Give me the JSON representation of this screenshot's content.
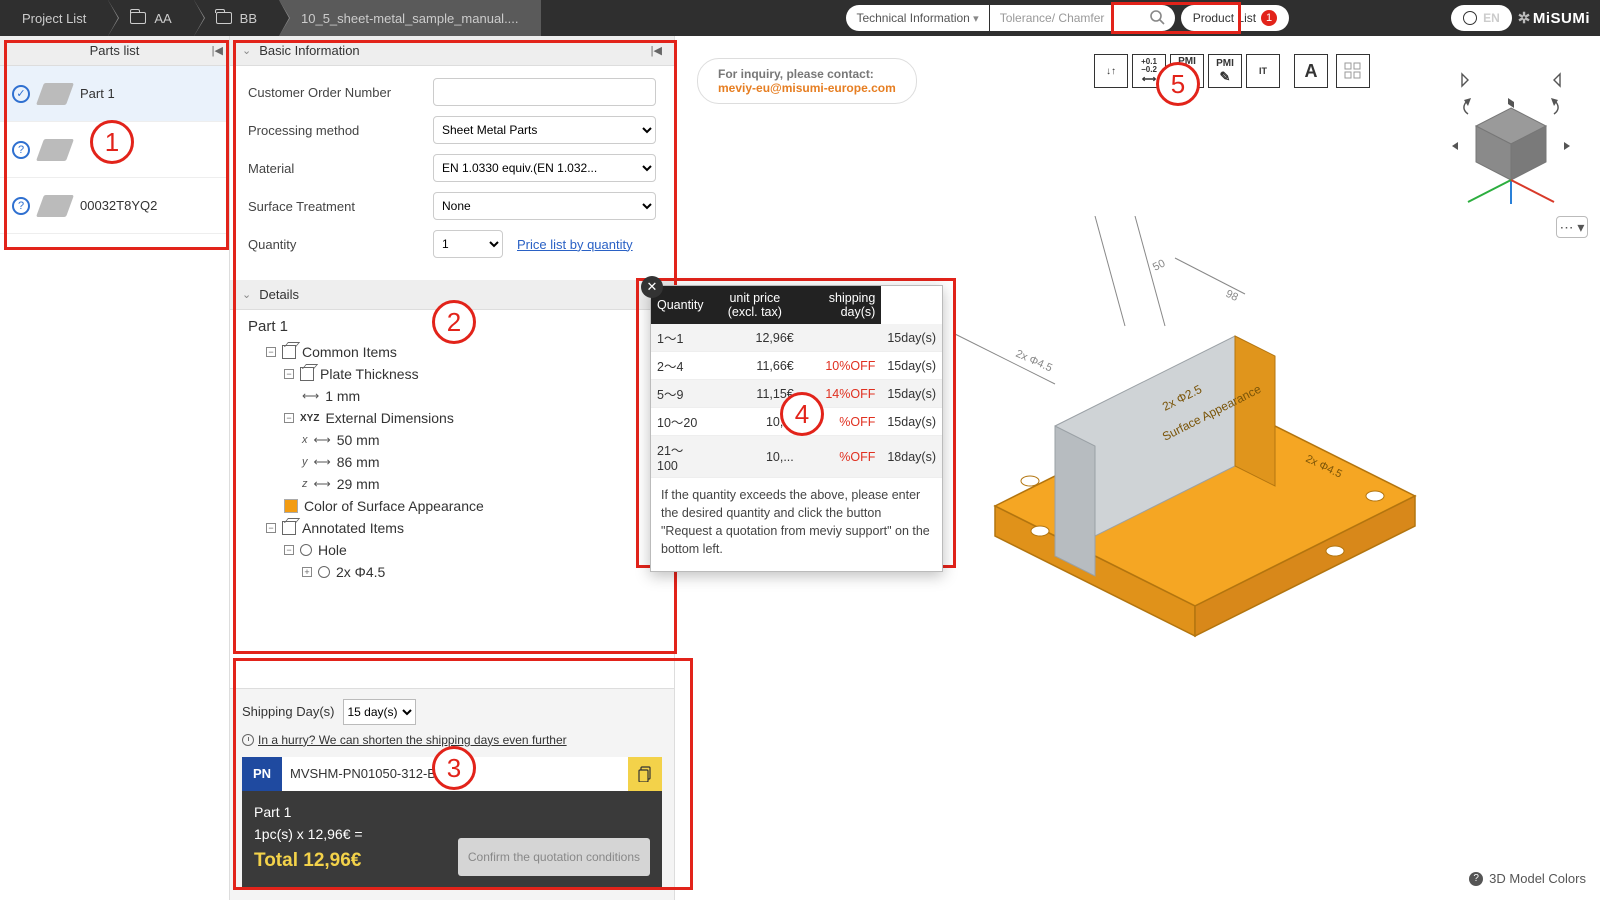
{
  "topbar": {
    "project_list": "Project List",
    "crumb_aa": "AA",
    "crumb_bb": "BB",
    "crumb_file": "10_5_sheet-metal_sample_manual....",
    "tech_info": "Technical Information",
    "search_placeholder": "Tolerance/ Chamfer",
    "product_list": "Product List",
    "product_badge": "1",
    "lang": "EN",
    "brand": "MiSUMi"
  },
  "sidebar": {
    "title": "Parts list",
    "items": [
      {
        "label": "Part 1",
        "status": "ok"
      },
      {
        "label": "",
        "status": "q"
      },
      {
        "label": "00032T8YQ2",
        "status": "q"
      }
    ]
  },
  "basic": {
    "title": "Basic Information",
    "order_label": "Customer Order Number",
    "method_label": "Processing method",
    "method_value": "Sheet Metal Parts",
    "material_label": "Material",
    "material_value": "EN 1.0330 equiv.(EN 1.032...",
    "surface_label": "Surface Treatment",
    "surface_value": "None",
    "qty_label": "Quantity",
    "qty_value": "1",
    "price_link": "Price list by quantity"
  },
  "details": {
    "title": "Details",
    "part_name": "Part 1",
    "common": "Common Items",
    "plate_thickness": "Plate Thickness",
    "thickness_val": "1 mm",
    "ext_dim": "External Dimensions",
    "dim_x": "50 mm",
    "dim_y": "86 mm",
    "dim_z": "29 mm",
    "color_label": "Color of Surface Appearance",
    "annotated": "Annotated Items",
    "hole": "Hole",
    "hole_spec": "2x Φ4.5"
  },
  "shipping": {
    "label": "Shipping Day(s)",
    "value": "15 day(s)",
    "hurry": "In a hurry? We can shorten the shipping days even further"
  },
  "price": {
    "pn_tag": "PN",
    "pn_value": "MVSHM-PN01050-312-B...",
    "part_label": "Part 1",
    "calc": "1pc(s)  x 12,96€ =",
    "total": "Total 12,96€",
    "confirm": "Confirm the quotation conditions"
  },
  "inquiry": {
    "text": "For inquiry, please contact:",
    "email": "meviy-eu@misumi-europe.com"
  },
  "popup": {
    "h_qty": "Quantity",
    "h_price": "unit price (excl. tax)",
    "h_ship": "shipping day(s)",
    "rows": [
      {
        "q": "1～1",
        "p": "12,96€",
        "off": "",
        "s": "15day(s)"
      },
      {
        "q": "2～4",
        "p": "11,66€",
        "off": "10%OFF",
        "s": "15day(s)"
      },
      {
        "q": "5～9",
        "p": "11,15€",
        "off": "14%OFF",
        "s": "15day(s)"
      },
      {
        "q": "10～20",
        "p": "10,...",
        "off": "%OFF",
        "s": "15day(s)"
      },
      {
        "q": "21～100",
        "p": "10,...",
        "off": "%OFF",
        "s": "18day(s)"
      }
    ],
    "note": "If the quantity exceeds the above, please enter the desired quantity and click the button \"Request a quotation from meviy support\" on the bottom left."
  },
  "footer": {
    "model_colors": "3D Model Colors"
  },
  "callouts": {
    "c1": "1",
    "c2": "2",
    "c3": "3",
    "c4": "4",
    "c5": "5"
  }
}
